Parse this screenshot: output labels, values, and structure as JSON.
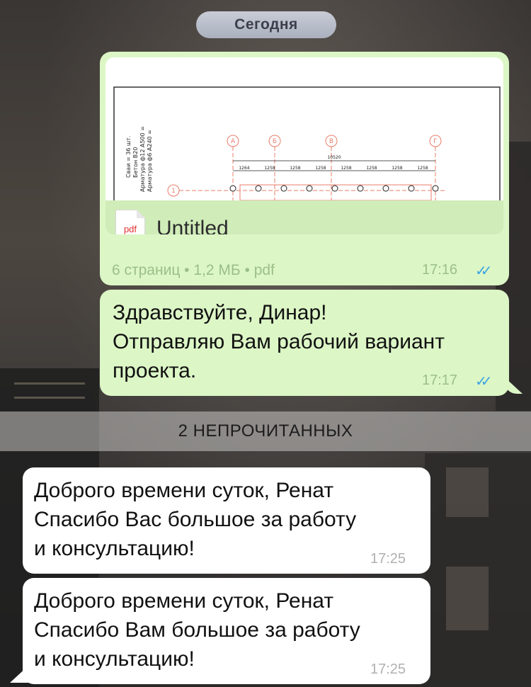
{
  "date_separator": "Сегодня",
  "messages": [
    {
      "type": "file",
      "direction": "outgoing",
      "file_name": "Untitled",
      "file_icon": "pdf",
      "file_meta": "6 страниц • 1,2 МБ • pdf",
      "time": "17:16",
      "status": "read-double-check",
      "preview": {
        "side_notes": [
          "Сваи = 36 шт.",
          "Бетон В20",
          "Арматура ф12 А500 =",
          "Арматура ф6 А240 ="
        ],
        "axis_labels": [
          "А",
          "Б",
          "В",
          "Г",
          "1"
        ],
        "total_dimension": "10520",
        "span_dimensions": [
          "1264",
          "1258",
          "1258",
          "1258",
          "1258",
          "1258",
          "1258",
          "1258"
        ]
      }
    },
    {
      "type": "text",
      "direction": "outgoing",
      "lines": [
        "Здравствуйте, Динар!",
        "Отправляю Вам рабочий вариант",
        "проекта."
      ],
      "time": "17:17",
      "status": "read-double-check"
    }
  ],
  "unread_divider": "2 НЕПРОЧИТАННЫХ",
  "incoming": [
    {
      "lines": [
        "Доброго времени суток, Ренат",
        "Спасибо Вас большое за работу",
        "и консультацию!"
      ],
      "time": "17:25"
    },
    {
      "lines": [
        "Доброго времени суток, Ренат",
        "Спасибо Вам большое за работу",
        "и консультацию!"
      ],
      "time": "17:25"
    }
  ],
  "colors": {
    "outgoing_bubble": "#dcf6c6",
    "incoming_bubble": "#ffffff",
    "check_color": "#3aa3e3",
    "pdf_red": "#e0302e"
  }
}
